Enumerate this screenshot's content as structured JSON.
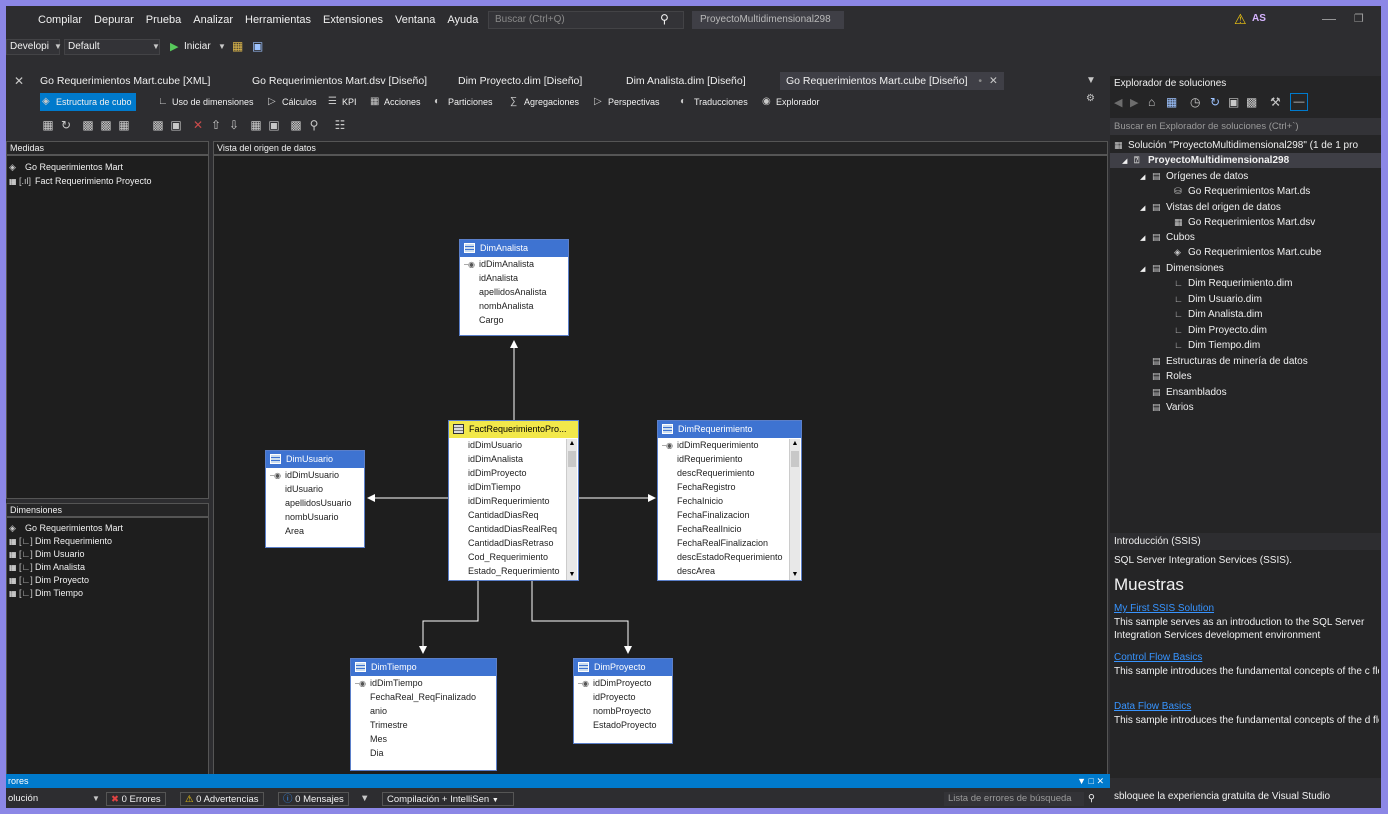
{
  "menu": {
    "items": [
      "Compilar",
      "Depurar",
      "Prueba",
      "Analizar",
      "Herramientas",
      "Extensiones",
      "Ventana",
      "Ayuda"
    ],
    "search_placeholder": "Buscar (Ctrl+Q)",
    "project_name": "ProyectoMultidimensional298",
    "user_initials": "AS"
  },
  "toolbar": {
    "config": "Developi",
    "platform": "Default",
    "start_label": "Iniciar"
  },
  "doc_tabs": [
    "Go Requerimientos Mart.cube [XML]",
    "Go Requerimientos Mart.dsv [Diseño]",
    "Dim Proyecto.dim [Diseño]",
    "Dim Analista.dim [Diseño]",
    "Go Requerimientos Mart.cube [Diseño]"
  ],
  "cube_tabs": [
    "Estructura de cubo",
    "Uso de dimensiones",
    "Cálculos",
    "KPI",
    "Acciones",
    "Particiones",
    "Agregaciones",
    "Perspectivas",
    "Traducciones",
    "Explorador"
  ],
  "measures": {
    "header": "Medidas",
    "cube": "Go Requerimientos Mart",
    "group": "Fact Requerimiento Proyecto"
  },
  "dimensions": {
    "header": "Dimensiones",
    "cube": "Go Requerimientos Mart",
    "items": [
      "Dim Requerimiento",
      "Dim Usuario",
      "Dim Analista",
      "Dim Proyecto",
      "Dim Tiempo"
    ]
  },
  "dsv": {
    "header": "Vista del origen de datos",
    "tables": {
      "analista": {
        "name": "DimAnalista",
        "key": "idDimAnalista",
        "cols": [
          "idAnalista",
          "apellidosAnalista",
          "nombAnalista",
          "Cargo"
        ]
      },
      "usuario": {
        "name": "DimUsuario",
        "key": "idDimUsuario",
        "cols": [
          "idUsuario",
          "apellidosUsuario",
          "nombUsuario",
          "Area"
        ]
      },
      "fact": {
        "name": "FactRequerimientoPro...",
        "cols": [
          "idDimUsuario",
          "idDimAnalista",
          "idDimProyecto",
          "idDimTiempo",
          "idDimRequerimiento",
          "CantidadDiasReq",
          "CantidadDiasRealReq",
          "CantidadDiasRetraso",
          "Cod_Requerimiento",
          "Estado_Requerimiento"
        ]
      },
      "requerimiento": {
        "name": "DimRequerimiento",
        "key": "idDimRequerimiento",
        "cols": [
          "idRequerimiento",
          "descRequerimiento",
          "FechaRegistro",
          "FechaInicio",
          "FechaFinalizacion",
          "FechaRealInicio",
          "FechaRealFinalizacion",
          "descEstadoRequerimiento",
          "descArea"
        ]
      },
      "tiempo": {
        "name": "DimTiempo",
        "key": "idDimTiempo",
        "cols": [
          "FechaReal_ReqFinalizado",
          "anio",
          "Trimestre",
          "Mes",
          "Dia"
        ]
      },
      "proyecto": {
        "name": "DimProyecto",
        "key": "idDimProyecto",
        "cols": [
          "idProyecto",
          "nombProyecto",
          "EstadoProyecto"
        ]
      }
    }
  },
  "solution_explorer": {
    "title": "Explorador de soluciones",
    "search_placeholder": "Buscar en Explorador de soluciones (Ctrl+`)",
    "solution": "Solución \"ProyectoMultidimensional298\" (1 de 1 pro",
    "project": "ProyectoMultidimensional298",
    "datasources": "Orígenes de datos",
    "datasource_item": "Go Requerimientos Mart.ds",
    "dsv_folder": "Vistas del origen de datos",
    "dsv_item": "Go Requerimientos Mart.dsv",
    "cubes": "Cubos",
    "cube_item": "Go Requerimientos Mart.cube",
    "dims_folder": "Dimensiones",
    "dim_items": [
      "Dim Requerimiento.dim",
      "Dim Usuario.dim",
      "Dim Analista.dim",
      "Dim Proyecto.dim",
      "Dim Tiempo.dim"
    ],
    "mining": "Estructuras de minería de datos",
    "roles": "Roles",
    "assemblies": "Ensamblados",
    "misc": "Varios"
  },
  "intro": {
    "header": "Introducción (SSIS)",
    "subtitle": "SQL Server Integration Services (SSIS).",
    "heading": "Muestras",
    "samples": [
      {
        "link": "My First SSIS Solution",
        "desc": "This sample serves as an introduction to the SQL Server Integration Services development environment"
      },
      {
        "link": "Control Flow Basics",
        "desc": "This sample introduces the fundamental concepts of the c flow"
      },
      {
        "link": "Data Flow Basics",
        "desc": "This sample introduces the fundamental concepts of the d flow"
      }
    ]
  },
  "errors": {
    "title": "rores",
    "scope": "olución",
    "errors_label": "0 Errores",
    "warnings_label": "0 Advertencias",
    "messages_label": "0 Mensajes",
    "build_filter": "Compilación + IntelliSen",
    "search_placeholder": "Lista de errores de búsqueda"
  },
  "vs_unlock": "sbloquee la experiencia gratuita de Visual Studio",
  "colors": {
    "accent": "#007acc",
    "frame": "#8c87e6",
    "table_header": "#3e73d1",
    "fact_header": "#f2e84a"
  }
}
